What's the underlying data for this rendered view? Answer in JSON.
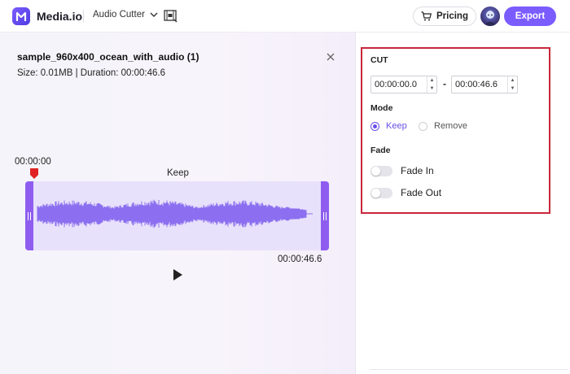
{
  "app": {
    "name": "Media.io",
    "tool_menu_label": "Audio Cutter",
    "pricing_label": "Pricing",
    "export_label": "Export"
  },
  "file": {
    "name": "sample_960x400_ocean_with_audio (1)",
    "meta": "Size: 0.01MB | Duration: 00:00:46.6"
  },
  "timeline": {
    "start_time": "00:00:00",
    "selection_label": "Keep",
    "end_time": "00:00:46.6",
    "playhead_position": 0
  },
  "cut_panel": {
    "title": "CUT",
    "start_value": "00:00:00.0",
    "end_value": "00:00:46.6",
    "separator": "-",
    "mode_title": "Mode",
    "mode_options": [
      {
        "label": "Keep",
        "selected": true
      },
      {
        "label": "Remove",
        "selected": false
      }
    ],
    "fade_title": "Fade",
    "fade_options": [
      {
        "label": "Fade In",
        "enabled": false
      },
      {
        "label": "Fade Out",
        "enabled": false
      }
    ]
  },
  "colors": {
    "accent": "#7b5cff",
    "waveform": "#8b6ff0",
    "highlight_border": "#c8273b",
    "playhead": "#e02222"
  },
  "icons": {
    "logo": "media-io-logo-icon",
    "dropdown": "chevron-down-icon",
    "video": "film-crop-icon",
    "cart": "cart-icon",
    "close": "close-icon",
    "play": "play-icon",
    "playhead": "playhead-marker-icon"
  }
}
